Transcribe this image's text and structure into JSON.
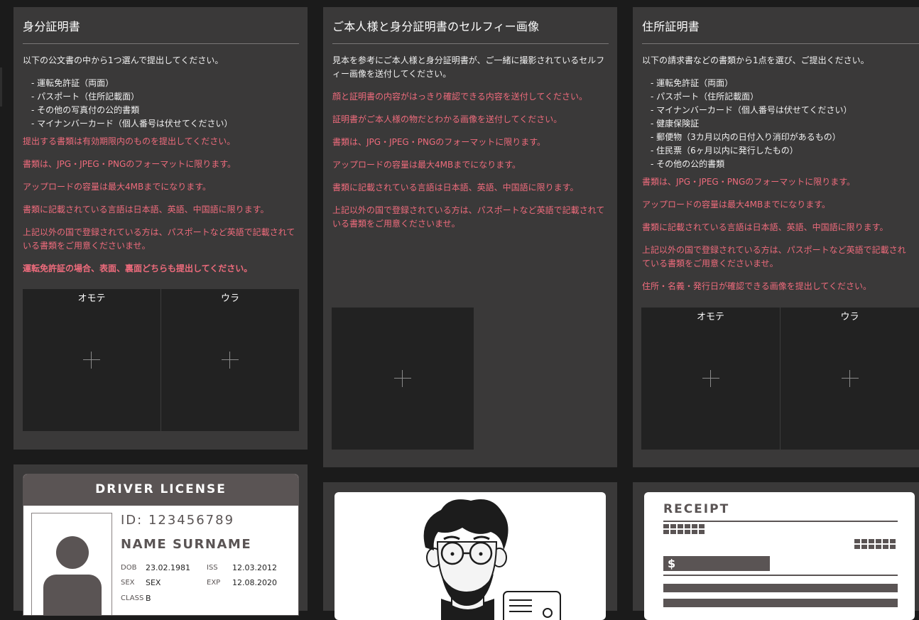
{
  "panels": [
    {
      "title": "身分証明書",
      "intro": "以下の公文書の中から1つ選んで提出してください。",
      "list": [
        "運転免許証（両面）",
        "パスポート（住所記載面）",
        "その他の写真付の公的書類",
        "マイナンバーカード（個人番号は伏せてください）"
      ],
      "notes": [
        "提出する書類は有効期限内のものを提出してください。",
        "書類は、JPG・JPEG・PNGのフォーマットに限ります。",
        "アップロードの容量は最大4MBまでになります。",
        "書類に記載されている言語は日本語、英語、中国語に限ります。",
        "上記以外の国で登録されている方は、パスポートなど英語で記載されている書類をご用意くださいませ。"
      ],
      "bold_note": "運転免許証の場合、表面、裏面どちらも提出してください。",
      "upload_front": "オモテ",
      "upload_back": "ウラ"
    },
    {
      "title": "ご本人様と身分証明書のセルフィー画像",
      "intro": "見本を参考にご本人様と身分証明書が、ご一緒に撮影されているセルフィー画像を送付してください。",
      "notes": [
        "顔と証明書の内容がはっきり確認できる内容を送付してください。",
        "証明書がご本人様の物だとわかる画像を送付してください。",
        "書類は、JPG・JPEG・PNGのフォーマットに限ります。",
        "アップロードの容量は最大4MBまでになります。",
        "書類に記載されている言語は日本語、英語、中国語に限ります。",
        "上記以外の国で登録されている方は、パスポートなど英語で記載されている書類をご用意くださいませ。"
      ]
    },
    {
      "title": "住所証明書",
      "intro": "以下の請求書などの書類から1点を選び、ご提出ください。",
      "list": [
        "運転免許証（両面）",
        "パスポート（住所記載面）",
        "マイナンバーカード（個人番号は伏せてください）",
        "健康保険証",
        "郵便物（3カ月以内の日付入り消印があるもの）",
        "住民票（6ヶ月以内に発行したもの）",
        "その他の公的書類"
      ],
      "notes": [
        "書類は、JPG・JPEG・PNGのフォーマットに限ります。",
        "アップロードの容量は最大4MBまでになります。",
        "書類に記載されている言語は日本語、英語、中国語に限ります。",
        "上記以外の国で登録されている方は、パスポートなど英語で記載されている書類をご用意くださいませ。",
        "住所・名義・発行日が確認できる画像を提出してください。"
      ],
      "upload_front": "オモテ",
      "upload_back": "ウラ"
    }
  ],
  "samples": {
    "license": {
      "header": "DRIVER LICENSE",
      "id": "ID: 123456789",
      "name": "NAME SURNAME",
      "dob_label": "DOB",
      "dob": "23.02.1981",
      "iss_label": "ISS",
      "iss": "12.03.2012",
      "sex_label": "SEX",
      "sex": "SEX",
      "exp_label": "EXP",
      "exp": "12.08.2020",
      "class_label": "CLASS",
      "class": "B"
    },
    "receipt": {
      "title": "RECEIPT",
      "currency": "$"
    }
  },
  "colors": {
    "panel": "#3a3939",
    "background": "#1b1b1b",
    "warning_text": "#ee6b7c",
    "upload_box": "#222222"
  }
}
